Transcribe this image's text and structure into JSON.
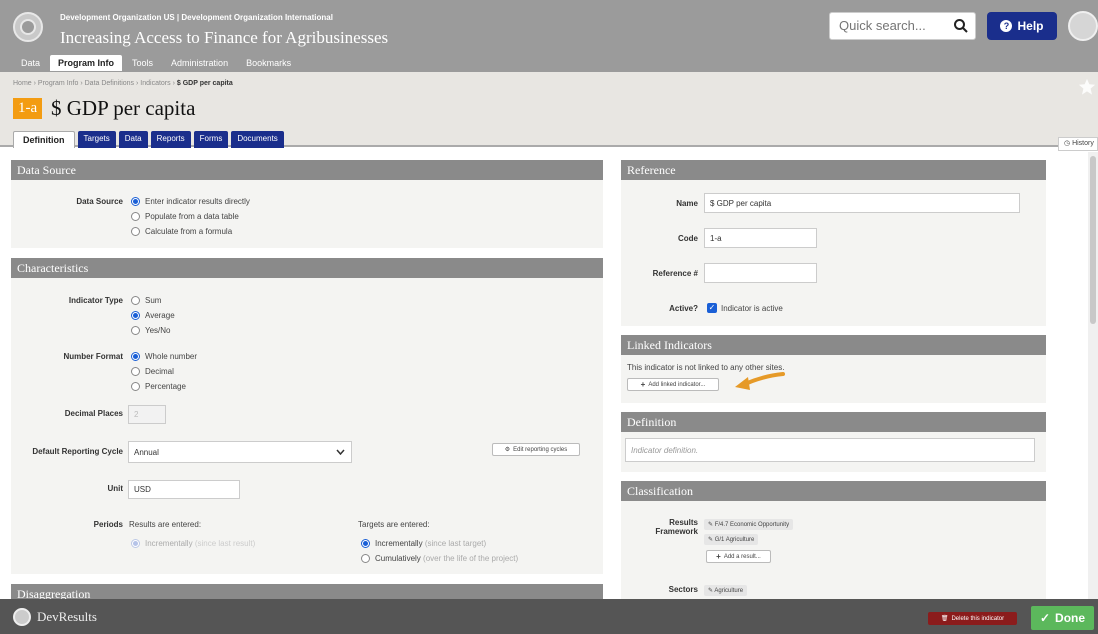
{
  "header": {
    "org_names": "Development Organization US | Development Organization International",
    "project_title": "Increasing Access to Finance for Agribusinesses",
    "search_placeholder": "Quick search...",
    "help_label": "Help",
    "nav": [
      "Data",
      "Program Info",
      "Tools",
      "Administration",
      "Bookmarks"
    ],
    "nav_active": "Program Info"
  },
  "page": {
    "breadcrumb": [
      "Home",
      "Program Info",
      "Data Definitions",
      "Indicators"
    ],
    "breadcrumb_current": "$ GDP per capita",
    "code": "1-a",
    "title": "$ GDP per capita",
    "tabs": [
      "Definition",
      "Targets",
      "Data",
      "Reports",
      "Forms",
      "Documents"
    ],
    "active_tab": "Definition",
    "history_label": "History"
  },
  "data_source": {
    "heading": "Data Source",
    "label": "Data Source",
    "options": [
      "Enter indicator results directly",
      "Populate from a data table",
      "Calculate from a formula"
    ],
    "selected": 0
  },
  "characteristics": {
    "heading": "Characteristics",
    "indicator_type_label": "Indicator Type",
    "indicator_type_options": [
      "Sum",
      "Average",
      "Yes/No"
    ],
    "indicator_type_selected": 1,
    "number_format_label": "Number Format",
    "number_format_options": [
      "Whole number",
      "Decimal",
      "Percentage"
    ],
    "number_format_selected": 0,
    "decimal_places_label": "Decimal Places",
    "decimal_places_value": "2",
    "reporting_cycle_label": "Default Reporting Cycle",
    "reporting_cycle_value": "Annual",
    "edit_cycles_label": "Edit reporting cycles",
    "unit_label": "Unit",
    "unit_value": "USD",
    "periods_label": "Periods",
    "results_entered_label": "Results are entered:",
    "results_option": "Incrementally",
    "results_option_note": "(since last result)",
    "targets_entered_label": "Targets are entered:",
    "targets_option_1": "Incrementally",
    "targets_option_1_note": "(since last target)",
    "targets_option_2": "Cumulatively",
    "targets_option_2_note": "(over the life of the project)"
  },
  "disaggregation": {
    "heading": "Disaggregation"
  },
  "reference": {
    "heading": "Reference",
    "name_label": "Name",
    "name_value": "$ GDP per capita",
    "code_label": "Code",
    "code_value": "1-a",
    "refnum_label": "Reference #",
    "refnum_value": "",
    "active_label": "Active?",
    "active_text": "Indicator is active"
  },
  "linked": {
    "heading": "Linked Indicators",
    "note": "This indicator is not linked to any other sites.",
    "add_label": "Add linked indicator..."
  },
  "definition": {
    "heading": "Definition",
    "placeholder": "Indicator definition."
  },
  "classification": {
    "heading": "Classification",
    "results_label_1": "Results",
    "results_label_2": "Framework",
    "results": [
      "F/4.7 Economic Opportunity",
      "G/1 Agriculture"
    ],
    "add_result_label": "Add a result...",
    "sectors_label": "Sectors",
    "sectors": [
      "Agriculture"
    ]
  },
  "footer": {
    "brand": "DevResults",
    "delete_label": "Delete this indicator",
    "done_label": "Done"
  },
  "colors": {
    "header_bg": "#9b9b9b",
    "primary_blue": "#1a2e8c",
    "badge_orange": "#f39c12",
    "panel_head": "#8a8a8a",
    "done_green": "#5cb85c",
    "delete_red": "#8b1c1c",
    "arrow_orange": "#e69a28"
  }
}
